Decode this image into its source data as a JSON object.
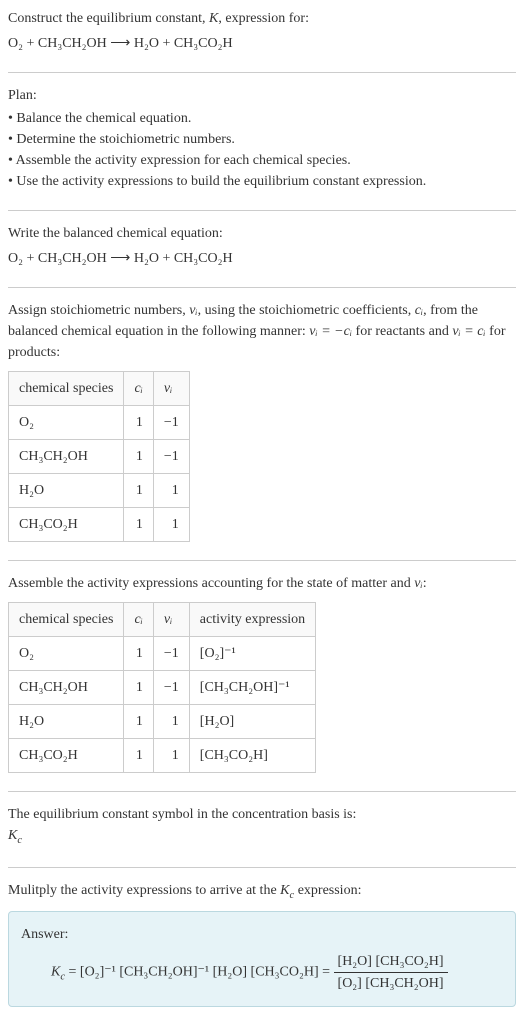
{
  "intro": {
    "line1_pre": "Construct the equilibrium constant, ",
    "line1_k": "K",
    "line1_post": ", expression for:",
    "equation": "O₂ + CH₃CH₂OH ⟶ H₂O + CH₃CO₂H"
  },
  "plan": {
    "title": "Plan:",
    "items": [
      "Balance the chemical equation.",
      "Determine the stoichiometric numbers.",
      "Assemble the activity expression for each chemical species.",
      "Use the activity expressions to build the equilibrium constant expression."
    ]
  },
  "balanced": {
    "title": "Write the balanced chemical equation:",
    "equation": "O₂ + CH₃CH₂OH ⟶ H₂O + CH₃CO₂H"
  },
  "stoich": {
    "text_pre": "Assign stoichiometric numbers, ",
    "nu": "νᵢ",
    "text_mid1": ", using the stoichiometric coefficients, ",
    "ci": "cᵢ",
    "text_mid2": ", from the balanced chemical equation in the following manner: ",
    "eq1": "νᵢ = −cᵢ",
    "text_mid3": " for reactants and ",
    "eq2": "νᵢ = cᵢ",
    "text_post": " for products:",
    "headers": {
      "species": "chemical species",
      "ci": "cᵢ",
      "nu": "νᵢ"
    },
    "rows": [
      {
        "species": "O₂",
        "ci": "1",
        "nu": "−1"
      },
      {
        "species": "CH₃CH₂OH",
        "ci": "1",
        "nu": "−1"
      },
      {
        "species": "H₂O",
        "ci": "1",
        "nu": "1"
      },
      {
        "species": "CH₃CO₂H",
        "ci": "1",
        "nu": "1"
      }
    ]
  },
  "activity": {
    "text_pre": "Assemble the activity expressions accounting for the state of matter and ",
    "nu": "νᵢ",
    "text_post": ":",
    "headers": {
      "species": "chemical species",
      "ci": "cᵢ",
      "nu": "νᵢ",
      "expr": "activity expression"
    },
    "rows": [
      {
        "species": "O₂",
        "ci": "1",
        "nu": "−1",
        "expr": "[O₂]⁻¹"
      },
      {
        "species": "CH₃CH₂OH",
        "ci": "1",
        "nu": "−1",
        "expr": "[CH₃CH₂OH]⁻¹"
      },
      {
        "species": "H₂O",
        "ci": "1",
        "nu": "1",
        "expr": "[H₂O]"
      },
      {
        "species": "CH₃CO₂H",
        "ci": "1",
        "nu": "1",
        "expr": "[CH₃CO₂H]"
      }
    ]
  },
  "symbol": {
    "line1": "The equilibrium constant symbol in the concentration basis is:",
    "kc": "K_c"
  },
  "multiply": {
    "text_pre": "Mulitply the activity expressions to arrive at the ",
    "kc": "K_c",
    "text_post": " expression:"
  },
  "answer": {
    "label": "Answer:",
    "kc": "K_c",
    "eq": " = [O₂]⁻¹ [CH₃CH₂OH]⁻¹ [H₂O] [CH₃CO₂H] = ",
    "frac_num": "[H₂O] [CH₃CO₂H]",
    "frac_den": "[O₂] [CH₃CH₂OH]"
  }
}
